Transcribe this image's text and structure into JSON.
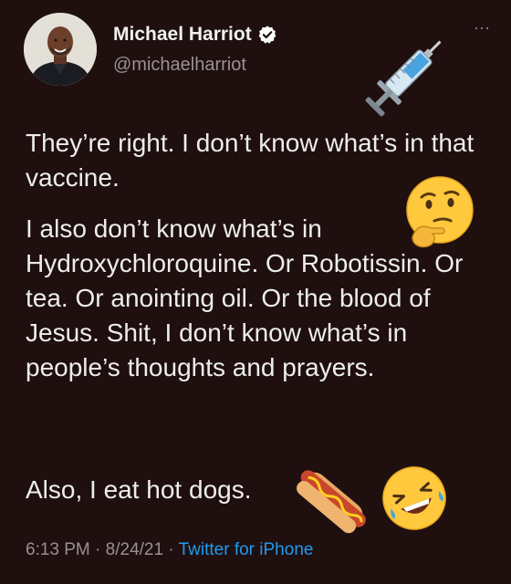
{
  "tweet": {
    "author": {
      "display_name": "Michael Harriot",
      "handle": "@michaelharriot",
      "verified": true
    },
    "more_label": "⋯",
    "paragraphs": [
      "They’re right. I don’t know what’s in that vaccine.",
      "I also don’t know what’s in Hydroxychloroquine. Or Robotissin. Or tea. Or anointing oil. Or the blood of Jesus. Shit, I don’t know what’s in people’s thoughts and prayers.",
      "Also, I eat hot dogs."
    ],
    "time": "6:13 PM",
    "separator": "·",
    "date": "8/24/21",
    "source": "Twitter for iPhone"
  },
  "emojis": [
    "syringe-icon",
    "thinking-face-icon",
    "hot-dog-icon",
    "rolling-on-floor-laughing-icon"
  ],
  "colors": {
    "background": "#1f0f0f",
    "text": "#ededed",
    "muted": "#9a9191",
    "link": "#1d9bf0",
    "verified": "#ffffff"
  }
}
